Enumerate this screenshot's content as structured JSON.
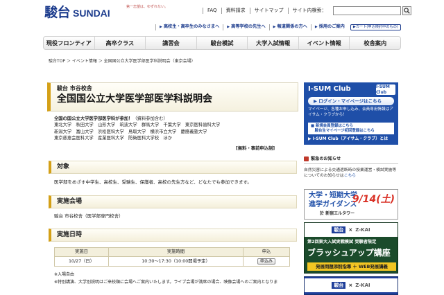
{
  "header": {
    "logo_kanji": "駿台",
    "logo_en": "SUNDAI",
    "logo_tagline": "第一志望は、ゆずれない。",
    "top_links": [
      "FAQ",
      "資料請求",
      "サイトマップ",
      "サイト内検索："
    ],
    "sub_links": [
      "高校生・高卒生のみなさまへ",
      "高等学校の先生へ",
      "報道関係の方へ",
      "採用のご案内"
    ],
    "cart_label": "カート(申込検討中のもの)"
  },
  "nav": {
    "items": [
      "現役フロンティア",
      "高卒クラス",
      "講習会",
      "駿台模試",
      "大学入試情報",
      "イベント情報",
      "校舎案内"
    ]
  },
  "breadcrumb": "駿台TOP ＞ イベント情報 ＞ 全国国公立大学医学部医学科説明会（東京会場）",
  "main": {
    "title_sub": "駿台 市谷校舎",
    "title": "全国国公立大学医学部医学科説明会",
    "intro_lead": "全国の国公立大学医学部医学科が参加！",
    "intro_lead_note": "（資料参加含む）",
    "universities": [
      "東北大学　秋田大学　山形大学　筑波大学　群馬大学　千葉大学　東京医科歯科大学",
      "新潟大学　富山大学　浜松医科大学　鳥取大学　横浜市立大学　慶應義塾大学",
      "東京慈恵会医科大学　産業医科大学　防衛医科大学校　ほか"
    ],
    "fee_note": "[無料・事前申込制]",
    "sections": [
      {
        "title": "対象",
        "body": "医学部をめざす中学生、高校生、受験生、保護者、高校の先生方など、どなたでも参加できます。"
      },
      {
        "title": "実施会場",
        "body": "駿台 市谷校舎（医学部専門校舎）"
      },
      {
        "title": "実施日時"
      }
    ],
    "schedule": {
      "headers": [
        "実施日",
        "実施時間",
        "申込"
      ],
      "date": "10/27（日）",
      "time": "10:30～17:30（10:00開場予定）",
      "apply_label": "申込み"
    },
    "note1": "※入場自由",
    "note2": "※特別講演、大学別説明はご来校順に会場へご案内いたします。ライブ会場が満席の場合、映像会場へのご案内となりま"
  },
  "sidebar": {
    "isum_title": "I-SUM Club",
    "isum_badge": "I-SUM Club",
    "isum_login": "ログイン・マイページはこちら",
    "isum_desc": "マイページ、各種お申し込み、会員専用情報はアイサム・クラブから！",
    "isum_reg1": "新規会員登録はこちら",
    "isum_reg2": "駿台生マイページ初回登録はこちら",
    "isum_foot": "I-SUM Club（アイサム・クラブ）とは",
    "emergency_title": "緊急のお知らせ",
    "emergency_text": "自然災害による交通遮断時の授業運営・模試実施等についてのお知らせは",
    "emergency_more": "こちら",
    "banner1_line1": "大学・短期大学",
    "banner1_line2": "進学ガイダンス",
    "banner1_date": "9/14(土)",
    "banner1_venue": "於 新宿エルタワー",
    "banner2_logo_a": "駿台",
    "banner2_logo_b": "Z-KAI",
    "banner2_line1": "第2回東大入試実戦模試 受験者限定",
    "banner2_line2": "ブラッシュアップ講座",
    "banner2_line3": "発展問題添削指導 ＋ WEB発展講義",
    "banner3_logo_a": "駿台",
    "banner3_logo_b": "Z-KAI"
  }
}
